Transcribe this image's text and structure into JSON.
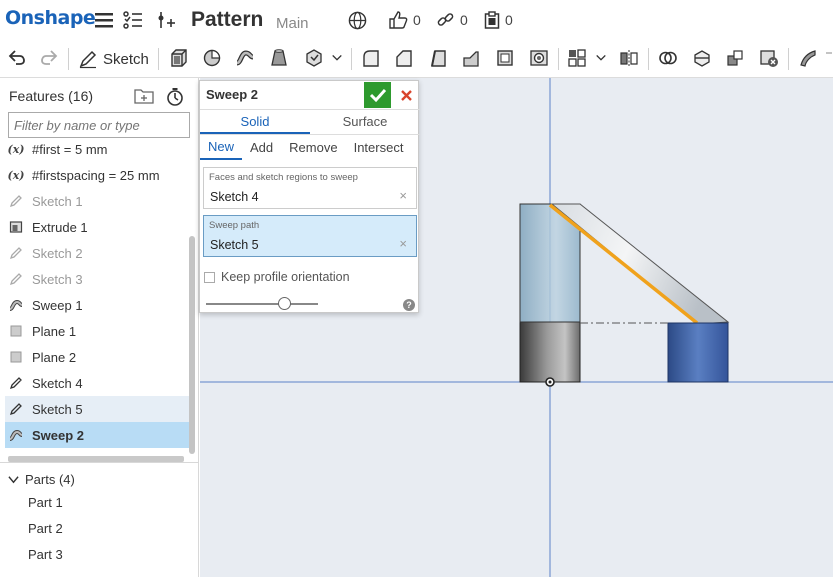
{
  "app": {
    "logo_text": "Onshape",
    "document_title": "Pattern",
    "branch": "Main",
    "likes_count": "0",
    "links_count": "0",
    "copies_count": "0"
  },
  "toolbar": {
    "sketch_label": "Sketch"
  },
  "feature_panel": {
    "title": "Features (16)",
    "filter_placeholder": "Filter by name or type",
    "items": [
      {
        "label": "#first = 5 mm",
        "icon": "variable-icon",
        "state": "normal"
      },
      {
        "label": "#firstspacing = 25 mm",
        "icon": "variable-icon",
        "state": "normal"
      },
      {
        "label": "Sketch 1",
        "icon": "sketch-icon",
        "state": "dim"
      },
      {
        "label": "Extrude 1",
        "icon": "extrude-icon",
        "state": "normal"
      },
      {
        "label": "Sketch 2",
        "icon": "sketch-icon",
        "state": "dim"
      },
      {
        "label": "Sketch 3",
        "icon": "sketch-icon",
        "state": "dim"
      },
      {
        "label": "Sweep 1",
        "icon": "sweep-icon",
        "state": "normal"
      },
      {
        "label": "Plane 1",
        "icon": "plane-icon",
        "state": "normal"
      },
      {
        "label": "Plane 2",
        "icon": "plane-icon",
        "state": "normal"
      },
      {
        "label": "Sketch 4",
        "icon": "sketch-icon",
        "state": "normal"
      },
      {
        "label": "Sketch 5",
        "icon": "sketch-icon",
        "state": "hover"
      },
      {
        "label": "Sweep 2",
        "icon": "sweep-icon",
        "state": "selected"
      }
    ],
    "parts_header": "Parts (4)",
    "parts": [
      "Part 1",
      "Part 2",
      "Part 3"
    ]
  },
  "dialog": {
    "title": "Sweep 2",
    "tabs": [
      "Solid",
      "Surface"
    ],
    "active_tab": "Solid",
    "operations": [
      "New",
      "Add",
      "Remove",
      "Intersect"
    ],
    "active_operation": "New",
    "profiles_label": "Faces and sketch regions to sweep",
    "profiles_value": "Sketch 4",
    "path_label": "Sweep path",
    "path_value": "Sketch 5",
    "keep_orientation_label": "Keep profile orientation",
    "keep_orientation_checked": false,
    "slider_value": 0.7
  },
  "colors": {
    "brand": "#1a63b8",
    "accept": "#2e9a2e",
    "cancel": "#d9432b",
    "selection": "#b8dcf5",
    "path_highlight": "#f0a21c",
    "part_blue": "#3f63a6"
  }
}
